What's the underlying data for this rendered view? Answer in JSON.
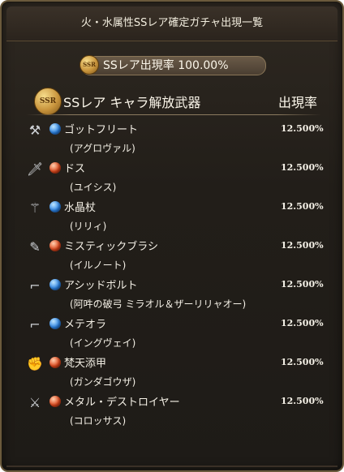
{
  "header": {
    "title": "火・水属性SSレア確定ガチャ出現一覧"
  },
  "rate_summary": {
    "badge": "SSR",
    "label": "SSレア出現率 100.00%"
  },
  "section": {
    "badge": "SSR",
    "title": "SSレア キャラ解放武器",
    "rate_header": "出現率"
  },
  "items": [
    {
      "name": "ゴットフリート",
      "character": "(アグロヴァル)",
      "rate": "12.500%",
      "element": "water",
      "weapon_icon": "axe-icon"
    },
    {
      "name": "ドス",
      "character": "(ユイシス)",
      "rate": "12.500%",
      "element": "fire",
      "weapon_icon": "dagger-icon"
    },
    {
      "name": "水晶杖",
      "character": "(リリィ)",
      "rate": "12.500%",
      "element": "water",
      "weapon_icon": "staff-icon"
    },
    {
      "name": "ミスティックブラシ",
      "character": "(イルノート)",
      "rate": "12.500%",
      "element": "fire",
      "weapon_icon": "brush-icon"
    },
    {
      "name": "アシッドボルト",
      "character": "(阿吽の破弓 ミラオル＆ザーリリャオー)",
      "rate": "12.500%",
      "element": "water",
      "weapon_icon": "gun-icon"
    },
    {
      "name": "メテオラ",
      "character": "(イングヴェイ)",
      "rate": "12.500%",
      "element": "water",
      "weapon_icon": "gun-icon"
    },
    {
      "name": "梵天添甲",
      "character": "(ガンダゴウザ)",
      "rate": "12.500%",
      "element": "fire",
      "weapon_icon": "gauntlet-icon"
    },
    {
      "name": "メタル・デストロイヤー",
      "character": "(コロッサス)",
      "rate": "12.500%",
      "element": "fire",
      "weapon_icon": "swords-icon"
    }
  ],
  "colors": {
    "water": "#2f86e6",
    "fire": "#e04a1e",
    "gold": "#c9953d"
  }
}
